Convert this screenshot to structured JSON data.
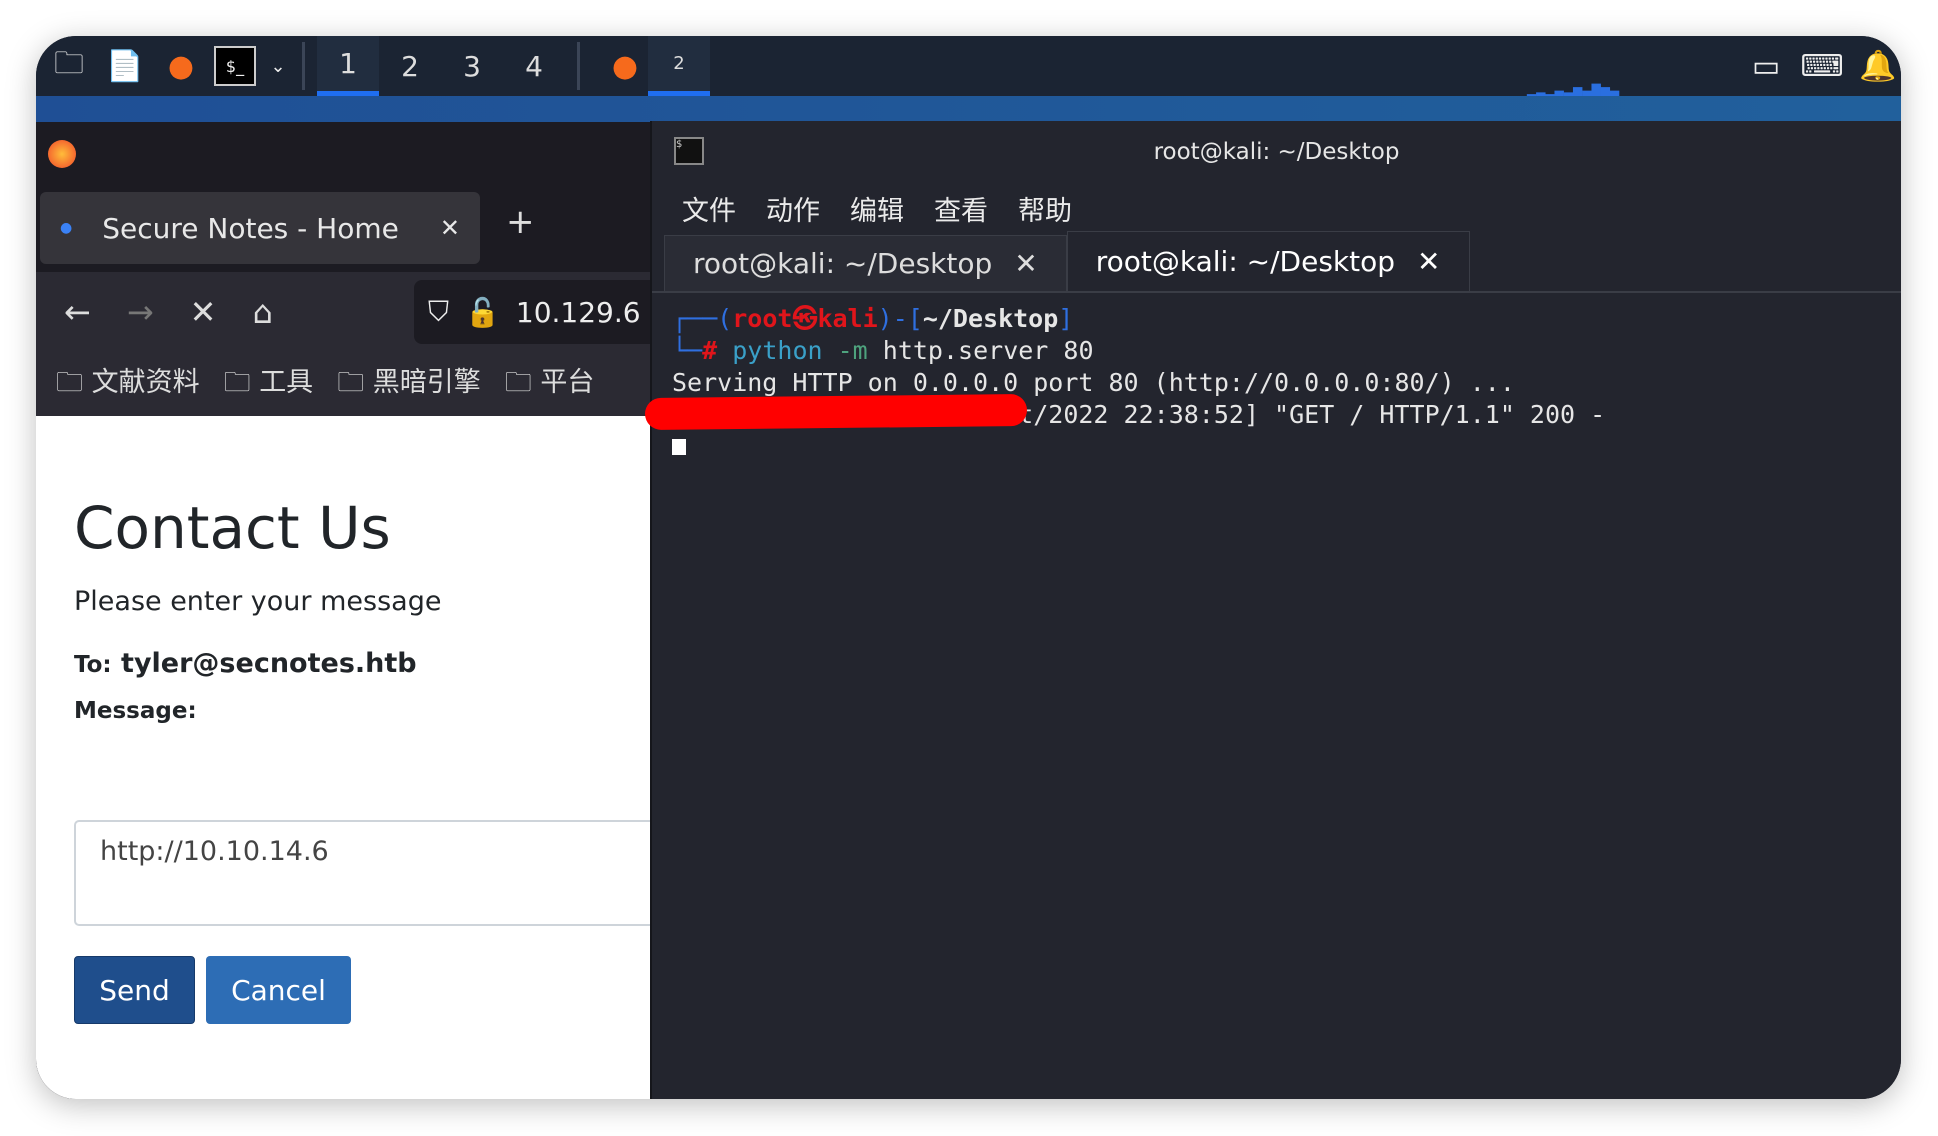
{
  "taskbar": {
    "workspaces": [
      "1",
      "2",
      "3",
      "4"
    ],
    "active_workspace": "1",
    "terminal_badge": "2"
  },
  "firefox": {
    "tab_title": "Secure Notes - Home",
    "url": "10.129.6",
    "bookmarks": [
      "文献资料",
      "工具",
      "黑暗引擎",
      "平台"
    ],
    "page": {
      "heading": "Contact Us",
      "subtitle": "Please enter your message",
      "to_label": "To:",
      "to_value": "tyler@secnotes.htb",
      "message_label": "Message:",
      "message_value": "http://10.10.14.6",
      "send": "Send",
      "cancel": "Cancel"
    }
  },
  "terminal": {
    "title": "root@kali: ~/Desktop",
    "menu": [
      "文件",
      "动作",
      "编辑",
      "查看",
      "帮助"
    ],
    "tabs": [
      "root@kali: ~/Desktop",
      "root@kali: ~/Desktop"
    ],
    "prompt": {
      "user": "root",
      "host": "kali",
      "path": "~/Desktop",
      "command_bin": "python",
      "command_flag": "-m",
      "command_args": "http.server 80"
    },
    "lines": [
      "Serving HTTP on 0.0.0.0 port 80 (http://0.0.0.0:80/) ...",
      "10.129.65.80 - - [31/Oct/2022 22:38:52] \"GET / HTTP/1.1\" 200 -"
    ]
  },
  "colors": {
    "accent": "#1f6ef0",
    "send_button": "#1f4e8c",
    "cancel_button": "#2d6db5",
    "redaction": "#ff0000"
  }
}
